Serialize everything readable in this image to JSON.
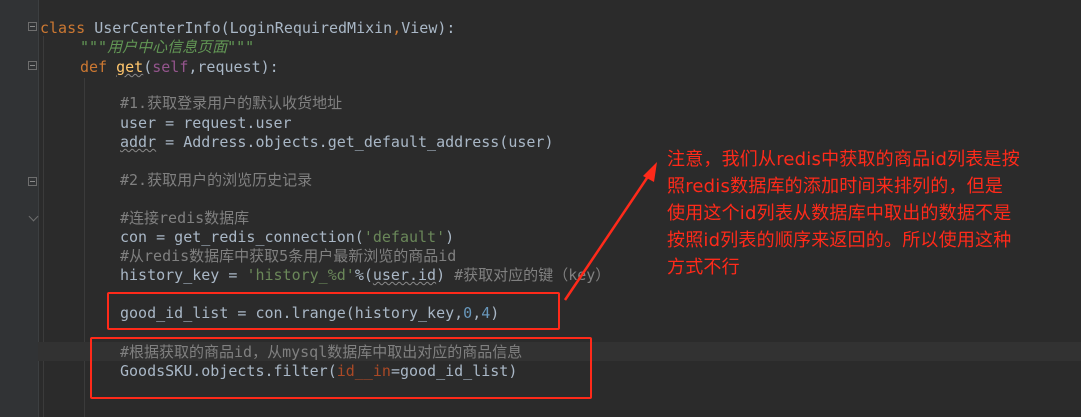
{
  "code": {
    "class_kw": "class",
    "class_name": "UserCenterInfo",
    "class_bases_open": "(",
    "base1": "LoginRequiredMixin",
    "comma": ",",
    "base2": "View",
    "class_tail": "):",
    "docstring": "\"\"\"用户中心信息页面\"\"\"",
    "def_kw": "def",
    "func_name": "get",
    "paren_open": "(",
    "self_kw": "self",
    "param_rest": ",request):",
    "comment1": "#1.获取登录用户的默认收货地址",
    "line_user": "user = request.user",
    "addr_var": "addr",
    "addr_rest": " = Address.objects.get_default_address(user)",
    "comment2": "#2.获取用户的浏览历史记录",
    "comment3": "#连接redis数据库",
    "con_prefix": "con = get_redis_connection(",
    "con_str": "'default'",
    "con_suffix": ")",
    "comment4": "#从redis数据库中获取5条用户最新浏览的商品id",
    "hk_prefix": "history_key = ",
    "hk_str": "'history_%d'",
    "hk_mid": "%(",
    "hk_arg": "user.id",
    "hk_close": ") ",
    "hk_comment": "#获取对应的键（key）",
    "gid_prefix": "good_id_list = con.lrange(history_key,",
    "gid_n1": "0",
    "gid_comma": ",",
    "gid_n2": "4",
    "gid_close": ")",
    "comment5": "#根据获取的商品id，从mysql数据库中取出对应的商品信息",
    "sku_prefix": "GoodsSKU.objects.filter(",
    "sku_param": "id__in",
    "sku_rest": "=good_id_list)"
  },
  "annotation": {
    "lines": [
      "注意，我们从redis中获取的商品id列表是按",
      "照redis数据库的添加时间来排列的，但是",
      "使用这个id列表从数据库中取出的数据不是",
      "按照id列表的顺序来返回的。所以使用这种",
      "方式不行"
    ],
    "color": "#ff2a1a"
  }
}
